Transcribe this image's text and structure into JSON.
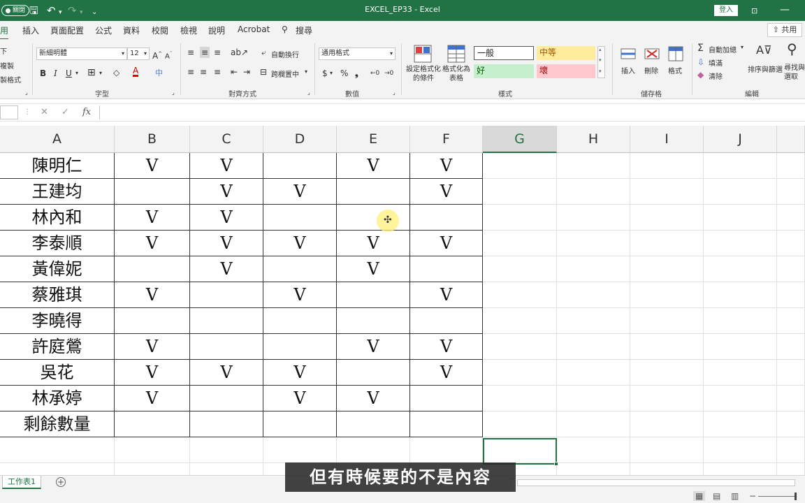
{
  "titlebar": {
    "autosave_label": "關閉",
    "title": "EXCEL_EP33  -  Excel",
    "signin_label": "登入",
    "save_icon": "save-icon",
    "undo_icon": "undo-icon",
    "redo_icon": "redo-icon"
  },
  "tabs": [
    "用",
    "插入",
    "頁面配置",
    "公式",
    "資料",
    "校閱",
    "檢視",
    "說明",
    "Acrobat",
    "搜尋"
  ],
  "share_label": "共用",
  "ribbon": {
    "clipboard": {
      "cut": "下",
      "copy": "複製",
      "format_painter": "製格式"
    },
    "font": {
      "name": "新細明體",
      "size": "12",
      "bold": "B",
      "italic": "I",
      "underline": "U",
      "group_label": "字型"
    },
    "alignment": {
      "wrap": "自動換行",
      "merge": "跨欄置中",
      "group_label": "對齊方式"
    },
    "number": {
      "format": "通用格式",
      "currency": "$",
      "percent": "%",
      "comma": "❟",
      "group_label": "數值"
    },
    "styles": {
      "conditional": "設定格式化的條件",
      "as_table": "格式化為表格",
      "normal": "一般",
      "neutral": "中等",
      "good": "好",
      "bad": "壞",
      "group_label": "樣式"
    },
    "cells": {
      "insert": "插入",
      "delete": "刪除",
      "format": "格式",
      "group_label": "儲存格"
    },
    "editing": {
      "autosum": "自動加總",
      "fill": "填滿",
      "clear": "清除",
      "sort": "排序與篩選",
      "find": "尋找與選取",
      "group_label": "編輯"
    }
  },
  "formula_bar": {
    "fx": "fx",
    "value": ""
  },
  "columns": [
    "A",
    "B",
    "C",
    "D",
    "E",
    "F",
    "G",
    "H",
    "I",
    "J"
  ],
  "selected_column": "G",
  "rows": [
    {
      "name": "陳明仁",
      "marks": [
        "V",
        "V",
        "",
        "V",
        "V"
      ]
    },
    {
      "name": "王建均",
      "marks": [
        "",
        "V",
        "V",
        "",
        "V"
      ]
    },
    {
      "name": "林內和",
      "marks": [
        "V",
        "V",
        "",
        "",
        ""
      ]
    },
    {
      "name": "李泰順",
      "marks": [
        "V",
        "V",
        "V",
        "V",
        "V"
      ]
    },
    {
      "name": "黃偉妮",
      "marks": [
        "",
        "V",
        "",
        "V",
        ""
      ]
    },
    {
      "name": "蔡雅琪",
      "marks": [
        "V",
        "",
        "V",
        "",
        "V"
      ]
    },
    {
      "name": "李曉得",
      "marks": [
        "",
        "",
        "",
        "",
        ""
      ]
    },
    {
      "name": "許庭鶯",
      "marks": [
        "V",
        "",
        "",
        "V",
        "V"
      ]
    },
    {
      "name": "吳花",
      "marks": [
        "V",
        "V",
        "V",
        "",
        "V"
      ]
    },
    {
      "name": "林承婷",
      "marks": [
        "V",
        "",
        "V",
        "V",
        ""
      ]
    },
    {
      "name": "剩餘數量",
      "marks": [
        "",
        "",
        "",
        "",
        ""
      ]
    }
  ],
  "sheet_tab": "工作表1",
  "subtitle": "但有時候要的不是內容"
}
